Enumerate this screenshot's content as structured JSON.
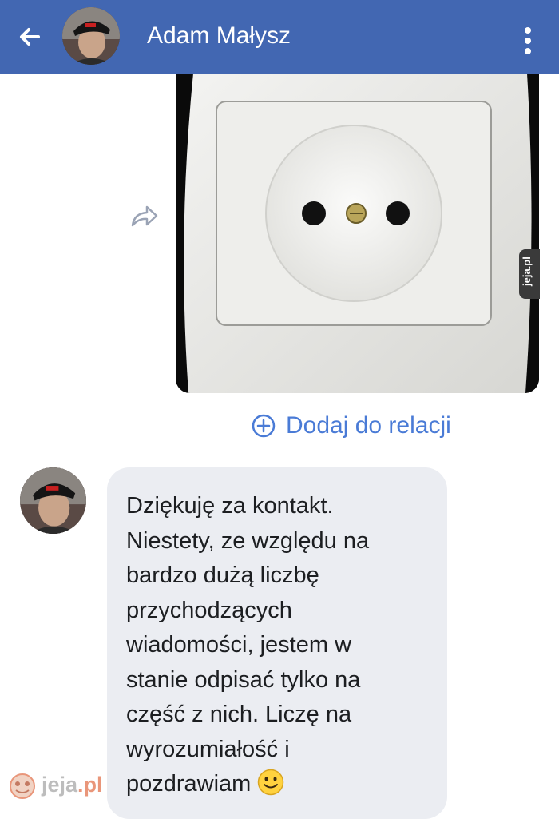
{
  "header": {
    "title": "Adam Małysz",
    "background_color": "#4267b2",
    "back_icon": "arrow-left-icon",
    "menu_icon": "vertical-dots-icon"
  },
  "conversation": {
    "sent_photo": {
      "description_icon": "power-outlet-photo",
      "forward_icon": "share-arrow-icon"
    },
    "add_to_story": {
      "icon": "plus-circle-icon",
      "label": "Dodaj do relacji",
      "color": "#4a7bd6"
    },
    "received_message": {
      "lines": [
        "Dziękuję za kontakt.",
        "Niestety, ze względu na",
        "bardzo dużą liczbę",
        "przychodzących",
        "wiadomości, jestem w",
        "stanie odpisać tylko na",
        "część z nich. Liczę na",
        "wyrozumiałość i",
        "pozdrawiam"
      ],
      "emoji": "slightly-smiling-face-icon",
      "bubble_color": "#ebedf2"
    }
  },
  "watermark": {
    "site_name": "jeja",
    "site_tld": ".pl",
    "side_text": "jeja.pl"
  }
}
